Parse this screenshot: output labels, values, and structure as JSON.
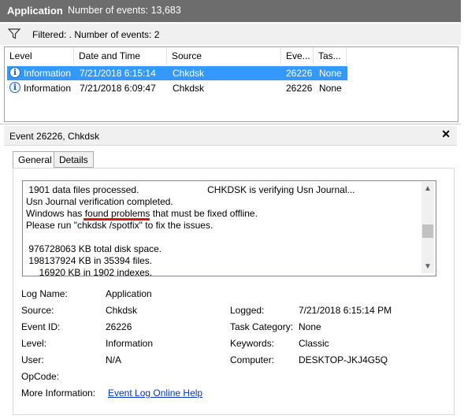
{
  "header": {
    "title": "Application",
    "event_count": "Number of events: 13,683"
  },
  "filter": {
    "text": "Filtered: . Number of events: 2",
    "icon": "funnel-icon"
  },
  "table": {
    "columns": [
      "Level",
      "Date and Time",
      "Source",
      "Eve...",
      "Tas..."
    ],
    "rows": [
      {
        "level": "Information",
        "datetime": "7/21/2018 6:15:14",
        "source": "Chkdsk",
        "event_id": "26226",
        "task": "None",
        "selected": true
      },
      {
        "level": "Information",
        "datetime": "7/21/2018 6:09:47",
        "source": "Chkdsk",
        "event_id": "26226",
        "task": "None",
        "selected": false
      }
    ]
  },
  "event_panel": {
    "title": "Event 26226, Chkdsk",
    "close": "✕",
    "tabs": [
      "General",
      "Details"
    ],
    "description_lines": [
      " 1901 data files processed.                          CHKDSK is verifying Usn Journal...",
      "Usn Journal verification completed.",
      "Windows has found problems that must be fixed offline.",
      "Please run \"chkdsk /spotfix\" to fix the issues.",
      "",
      " 976728063 KB total disk space.",
      " 198137924 KB in 35394 files.",
      "     16920 KB in 1902 indexes."
    ],
    "details": {
      "log_name_label": "Log Name:",
      "log_name": "Application",
      "source_label": "Source:",
      "source": "Chkdsk",
      "logged_label": "Logged:",
      "logged": "7/21/2018 6:15:14 PM",
      "event_id_label": "Event ID:",
      "event_id": "26226",
      "task_category_label": "Task Category:",
      "task_category": "None",
      "level_label": "Level:",
      "level": "Information",
      "keywords_label": "Keywords:",
      "keywords": "Classic",
      "user_label": "User:",
      "user": "N/A",
      "computer_label": "Computer:",
      "computer": "DESKTOP-JKJ4G5Q",
      "opcode_label": "OpCode:",
      "more_info_label": "More Information:",
      "more_info_link": "Event Log Online Help"
    }
  },
  "colors": {
    "header_bg": "#6d6d6d",
    "selection": "#3399ff",
    "annotation_underline": "#d01818",
    "link": "#0033cc"
  }
}
